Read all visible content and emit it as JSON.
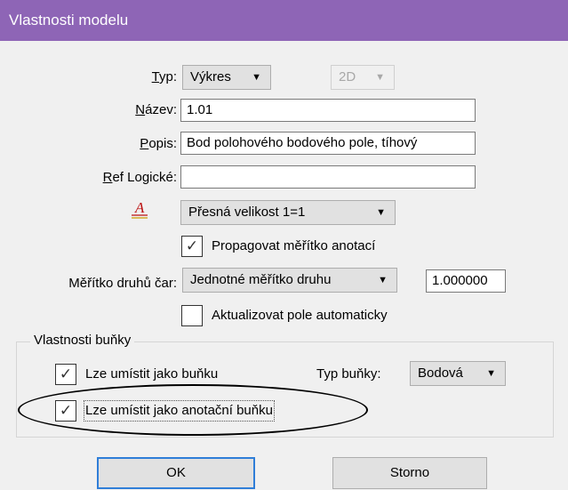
{
  "window": {
    "title": "Vlastnosti modelu"
  },
  "type": {
    "label": "Typ:",
    "value": "Výkres",
    "dimension": "2D"
  },
  "name": {
    "label": "Název:",
    "value": "1.01"
  },
  "description": {
    "label": "Popis:",
    "value": "Bod polohového bodového pole, tíhový"
  },
  "logical_ref": {
    "label": "Ref Logické:",
    "value": ""
  },
  "annotation_scale": {
    "icon": "annotation-scale-icon",
    "value": "Přesná velikost 1=1"
  },
  "propagate_scale": {
    "label": "Propagovat měřítko anotací",
    "checked": true
  },
  "line_style_scale": {
    "label": "Měřítko druhů čar:",
    "value": "Jednotné měřítko druhu",
    "factor": "1.000000"
  },
  "auto_update_fields": {
    "label": "Aktualizovat pole automaticky",
    "checked": false
  },
  "cell_properties": {
    "title": "Vlastnosti buňky",
    "place_as_cell": {
      "label": "Lze umístit jako buňku",
      "checked": true
    },
    "cell_type": {
      "label": "Typ buňky:",
      "value": "Bodová"
    },
    "place_as_annotation_cell": {
      "label": "Lze umístit jako anotační buňku",
      "checked": true
    }
  },
  "buttons": {
    "ok": "OK",
    "cancel": "Storno"
  },
  "colors": {
    "titlebar": "#8e65b6",
    "default_button_border": "#2f7ed8"
  }
}
